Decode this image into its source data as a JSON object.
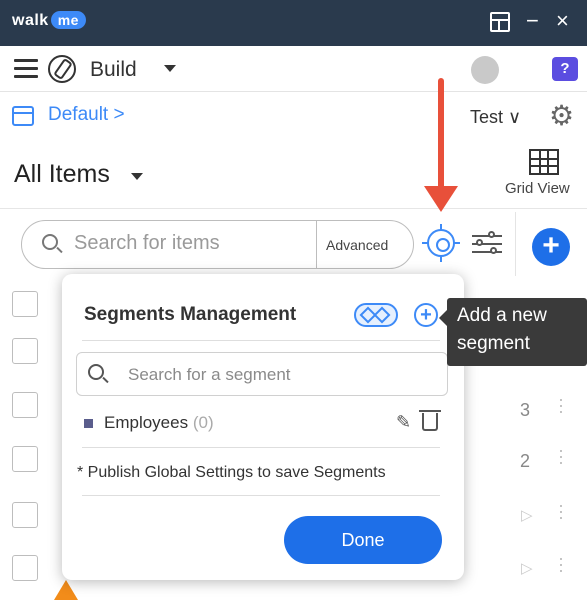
{
  "window": {
    "logo_text": "walk",
    "logo_badge": "me",
    "minimize_glyph": "−",
    "close_glyph": "×"
  },
  "topbar": {
    "mode_label": "Build",
    "help_glyph": "?"
  },
  "envbar": {
    "environment_label": "Default >",
    "test_label": "Test ∨"
  },
  "items": {
    "title": "All Items",
    "grid_view_label": "Grid View"
  },
  "search": {
    "placeholder": "Search for items",
    "advanced_label": "Advanced",
    "add_glyph": "+"
  },
  "list_rows": [
    {
      "count": "",
      "type": "header"
    },
    {
      "count": "",
      "type": "blank"
    },
    {
      "count": "3",
      "type": "count"
    },
    {
      "count": "2",
      "type": "count"
    },
    {
      "count": "",
      "type": "play"
    },
    {
      "count": "",
      "type": "play"
    }
  ],
  "segments_panel": {
    "title": "Segments Management",
    "search_placeholder": "Search for a segment",
    "segments": [
      {
        "name": "Employees",
        "count": "(0)",
        "color": "#5a5d8c"
      }
    ],
    "note": "* Publish Global Settings to save Segments",
    "done_label": "Done"
  },
  "tooltip": {
    "text": "Add a new segment"
  },
  "colors": {
    "accent": "#1e6fe8",
    "link": "#3d8af7",
    "annotation_arrow": "#e8503a",
    "titlebar": "#2a3a4d"
  }
}
